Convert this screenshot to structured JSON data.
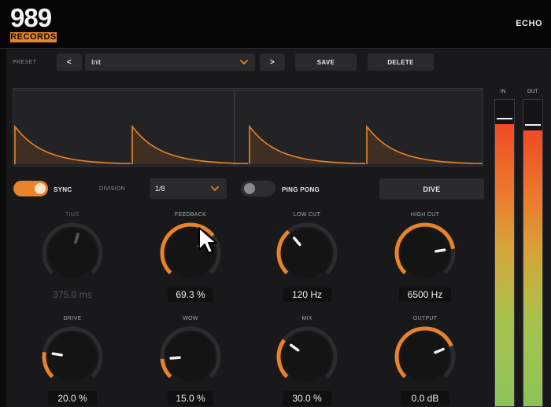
{
  "header": {
    "logo_number": "989",
    "logo_sub": "RECORDS",
    "product": "ECHO"
  },
  "preset": {
    "label": "PRESET",
    "prev": "<",
    "value": "Init",
    "next": ">",
    "save": "SAVE",
    "delete": "DELETE"
  },
  "controls": {
    "sync_label": "SYNC",
    "sync_on": true,
    "division_label": "DIVISION",
    "division_value": "1/8",
    "ping_pong_label": "PING PONG",
    "ping_pong_on": false,
    "dive_label": "DIVE"
  },
  "knobs": [
    {
      "id": "time",
      "title": "TIME",
      "value": "375.0 ms",
      "level": 0.56,
      "disabled": true
    },
    {
      "id": "feedback",
      "title": "FEEDBACK",
      "value": "69.3 %",
      "level": 0.693,
      "disabled": false
    },
    {
      "id": "low-cut",
      "title": "LOW CUT",
      "value": "120 Hz",
      "level": 0.35,
      "disabled": false
    },
    {
      "id": "high-cut",
      "title": "HIGH CUT",
      "value": "6500 Hz",
      "level": 0.8,
      "disabled": false
    },
    {
      "id": "drive",
      "title": "DRIVE",
      "value": "20.0 %",
      "level": 0.2,
      "disabled": false
    },
    {
      "id": "wow",
      "title": "WOW",
      "value": "15.0 %",
      "level": 0.15,
      "disabled": false
    },
    {
      "id": "mix",
      "title": "MIX",
      "value": "30.0 %",
      "level": 0.3,
      "disabled": false
    },
    {
      "id": "output",
      "title": "OUTPUT",
      "value": "0.0 dB",
      "level": 0.75,
      "disabled": false
    }
  ],
  "meters": {
    "in_label": "IN",
    "out_label": "OUT",
    "in_level": 0.92,
    "out_level": 0.9
  },
  "colors": {
    "accent": "#e8832a",
    "panel": "#19191b",
    "knob_track": "#2c2c2f"
  },
  "icons": {
    "chevron": "chevron-down-icon",
    "cursor": "mouse-pointer-icon"
  }
}
